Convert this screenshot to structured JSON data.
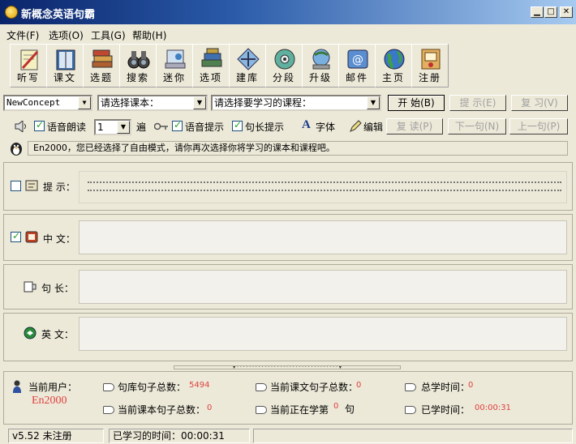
{
  "window": {
    "title": "新概念英语句霸"
  },
  "menu": [
    {
      "label": "文件(F)"
    },
    {
      "label": "选项(O)"
    },
    {
      "label": "工具(G)"
    },
    {
      "label": "帮助(H)"
    }
  ],
  "toolbar": {
    "items": [
      {
        "label": "听写",
        "icon": "dictation-icon"
      },
      {
        "label": "课文",
        "icon": "book-icon"
      },
      {
        "label": "选题",
        "icon": "books-stack-icon"
      },
      {
        "label": "搜索",
        "icon": "binoculars-icon"
      },
      {
        "label": "迷你",
        "icon": "mini-window-icon"
      },
      {
        "label": "选项",
        "icon": "options-books-icon"
      },
      {
        "label": "建库",
        "icon": "build-library-icon"
      },
      {
        "label": "分段",
        "icon": "segment-disc-icon"
      },
      {
        "label": "升级",
        "icon": "upgrade-globe-icon"
      },
      {
        "label": "邮件",
        "icon": "mail-icon"
      },
      {
        "label": "主页",
        "icon": "homepage-globe-icon"
      },
      {
        "label": "注册",
        "icon": "register-certificate-icon"
      }
    ]
  },
  "selectors": {
    "library": "NewConcept",
    "textbook": "请选择课本：",
    "lesson": "请选择要学习的课程：",
    "start": "开 始(B)",
    "hint": "提 示(E)",
    "review": "复 习(V)"
  },
  "options": {
    "voice_read": "语音朗读",
    "repeat_count": "1",
    "repeat_unit": "遍",
    "voice_hint": "语音提示",
    "length_hint": "句长提示",
    "font": "字体",
    "edit": "编辑",
    "reread": "复 读(P)",
    "next": "下一句(N)",
    "prev": "上一句(P)"
  },
  "message": "En2000，您已经选择了自由模式，请你再次选择你将学习的课本和课程吧。",
  "panels": {
    "hint_label": "提 示：",
    "chinese_label": "中 文：",
    "length_label": "句 长：",
    "english_label": "英 文："
  },
  "stats": {
    "current_user_label": "当前用户：",
    "current_user": "En2000",
    "total_sentences_label": "句库句子总数：",
    "total_sentences": "5494",
    "lesson_sentences_label": "当前课文句子总数：",
    "lesson_sentences": "0",
    "total_time_label": "总学时间：",
    "total_time": "0",
    "book_sentences_label": "当前课本句子总数：",
    "book_sentences": "0",
    "current_learning_label": "当前正在学第",
    "current_learning": "0",
    "current_learning_unit": "句",
    "learned_time_label": "已学时间：",
    "learned_time": "00:00:31"
  },
  "statusbar": {
    "version": "v5.52 未注册",
    "elapsed": "已学习的时间：00:00:31"
  },
  "colors": {
    "title_start": "#0a246a",
    "title_end": "#a6caf0",
    "value_red": "#e04040",
    "face": "#ece9d8"
  }
}
